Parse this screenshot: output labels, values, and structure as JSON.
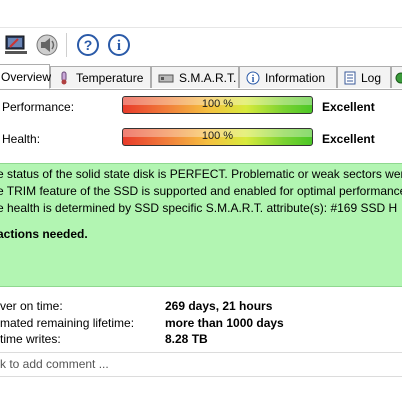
{
  "tabs": [
    {
      "label": "Overview",
      "icon": "overview-icon",
      "active": true
    },
    {
      "label": "Temperature",
      "icon": "thermometer-icon"
    },
    {
      "label": "S.M.A.R.T.",
      "icon": "smart-drive-icon"
    },
    {
      "label": "Information",
      "icon": "info-icon"
    },
    {
      "label": "Log",
      "icon": "log-icon"
    }
  ],
  "toolbar": {
    "icons": [
      "monitor-icon",
      "speaker-icon",
      "help-icon",
      "info-icon"
    ]
  },
  "performance": {
    "label": "Performance:",
    "percent_text": "100 %",
    "value": 100,
    "rating": "Excellent"
  },
  "health": {
    "label": "Health:",
    "percent_text": "100 %",
    "value": 100,
    "rating": "Excellent"
  },
  "status": {
    "line1": "e status of the solid state disk is PERFECT. Problematic or weak sectors were",
    "line2": "e TRIM feature of the SSD is supported and enabled for optimal performance",
    "line3": "e health is determined by SSD specific S.M.A.R.T. attribute(s):  #169 SSD H",
    "action": "actions needed.",
    "bg_color": "#b2f5b2"
  },
  "stats": [
    {
      "label": "ver on time:",
      "value": "269 days, 21 hours"
    },
    {
      "label": "mated remaining lifetime:",
      "value": "more than 1000 days"
    },
    {
      "label": "time writes:",
      "value": "8.28 TB"
    }
  ],
  "comment_placeholder": "k to add comment ..."
}
